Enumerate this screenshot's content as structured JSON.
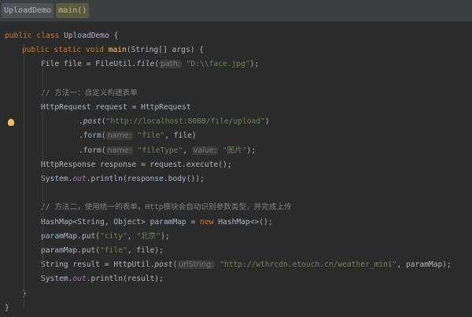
{
  "tabs": [
    "UploadDemo",
    "main()"
  ],
  "lines": [
    {
      "indent": 0,
      "tokens": [
        [
          "kw",
          "public class "
        ],
        [
          "",
          "UploadDemo {"
        ]
      ]
    },
    {
      "indent": 1,
      "tokens": [
        [
          "kw",
          "public static void "
        ],
        [
          "fn",
          "main"
        ],
        [
          "",
          "(String[] args) {"
        ]
      ]
    },
    {
      "indent": 2,
      "tokens": [
        [
          "",
          "File file = FileUtil."
        ],
        [
          "it",
          "file"
        ],
        [
          "",
          "("
        ],
        [
          "hint",
          "path:"
        ],
        [
          "str",
          " \"D:\\\\face.jpg\""
        ],
        [
          "",
          ");"
        ]
      ]
    },
    {
      "indent": 2,
      "tokens": []
    },
    {
      "indent": 2,
      "tokens": [
        [
          "cm",
          "// 方法一：自定义构建表单"
        ]
      ]
    },
    {
      "indent": 2,
      "tokens": [
        [
          "",
          "HttpRequest request = HttpRequest"
        ]
      ]
    },
    {
      "indent": 4,
      "tokens": [
        [
          "",
          "."
        ],
        [
          "it",
          "post"
        ],
        [
          "",
          "("
        ],
        [
          "str",
          "\"http://localhost:8080/file/upload\""
        ],
        [
          "",
          ")"
        ]
      ]
    },
    {
      "indent": 4,
      "tokens": [
        [
          "",
          ".form("
        ],
        [
          "hint",
          "name:"
        ],
        [
          "str",
          " \"file\""
        ],
        [
          "",
          ", file)"
        ]
      ]
    },
    {
      "indent": 4,
      "tokens": [
        [
          "",
          ".form("
        ],
        [
          "hint",
          "name:"
        ],
        [
          "str",
          " \"fileType\""
        ],
        [
          "",
          ", "
        ],
        [
          "hint",
          "value:"
        ],
        [
          "str",
          " \"图片\""
        ],
        [
          "",
          ");"
        ]
      ]
    },
    {
      "indent": 2,
      "tokens": [
        [
          "",
          "HttpResponse response = request.execute();"
        ]
      ]
    },
    {
      "indent": 2,
      "tokens": [
        [
          "",
          "System."
        ],
        [
          "st",
          "out"
        ],
        [
          "",
          ".println(response.body());"
        ]
      ]
    },
    {
      "indent": 2,
      "tokens": []
    },
    {
      "indent": 2,
      "tokens": [
        [
          "cm",
          "// 方法二，使用统一的表单，Http模块会自动识别参数类型，并完成上传"
        ]
      ]
    },
    {
      "indent": 2,
      "tokens": [
        [
          "",
          "HashMap<String, Object> paramMap = "
        ],
        [
          "kw",
          "new "
        ],
        [
          "",
          "HashMap<>();"
        ]
      ]
    },
    {
      "indent": 2,
      "tokens": [
        [
          "",
          "paramMap.put("
        ],
        [
          "str",
          "\"city\""
        ],
        [
          "",
          ", "
        ],
        [
          "str",
          "\"北京\""
        ],
        [
          "",
          ");"
        ]
      ]
    },
    {
      "indent": 2,
      "tokens": [
        [
          "",
          "paramMap.put("
        ],
        [
          "str",
          "\"file\""
        ],
        [
          "",
          ", file);"
        ]
      ]
    },
    {
      "indent": 2,
      "tokens": [
        [
          "",
          "String result = HttpUtil."
        ],
        [
          "it",
          "post"
        ],
        [
          "",
          "("
        ],
        [
          "hint",
          "urlString:"
        ],
        [
          "str",
          " \"http://wthrcdn.etouch.cn/weather_mini\""
        ],
        [
          "",
          ", paramMap);"
        ]
      ]
    },
    {
      "indent": 2,
      "tokens": [
        [
          "",
          "System."
        ],
        [
          "st",
          "out"
        ],
        [
          "",
          ".println(result);"
        ]
      ]
    },
    {
      "indent": 1,
      "tokens": [
        [
          "",
          "}"
        ]
      ]
    },
    {
      "indent": 0,
      "tokens": [
        [
          "",
          "}"
        ]
      ]
    }
  ]
}
